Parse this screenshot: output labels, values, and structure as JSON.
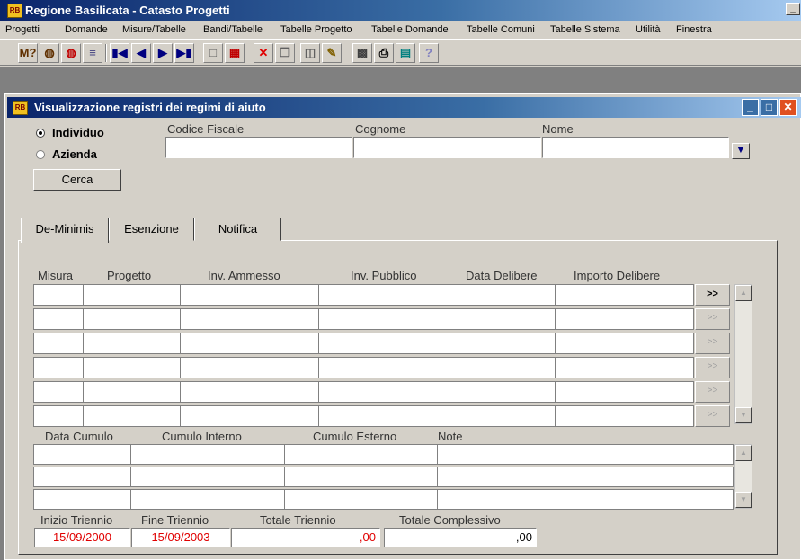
{
  "window": {
    "title": "Regione Basilicata - Catasto Progetti"
  },
  "menu": [
    "Progetti",
    "Domande",
    "Misure/Tabelle",
    "Bandi/Tabelle",
    "Tabelle Progetto",
    "Tabelle Domande",
    "Tabelle Comuni",
    "Tabelle Sistema",
    "Utilità",
    "Finestra"
  ],
  "toolbar_icons": [
    "search-plus-icon",
    "binoculars-icon",
    "binoculars-red-icon",
    "filter-icon",
    "first-record-icon",
    "prev-record-icon",
    "next-record-icon",
    "last-record-icon",
    "new-record-icon",
    "edit-record-icon",
    "delete-icon",
    "copy-icon",
    "paste-icon",
    "edit-pen-icon",
    "save-icon",
    "print-icon",
    "exit-icon",
    "help-icon"
  ],
  "child": {
    "title": "Visualizzazione registri dei regimi di aiuto"
  },
  "search": {
    "type_individuo": "Individuo",
    "type_azienda": "Azienda",
    "selected_type": "Individuo",
    "codice_fiscale_label": "Codice Fiscale",
    "cognome_label": "Cognome",
    "nome_label": "Nome",
    "codice_fiscale_value": "",
    "cognome_value": "",
    "nome_value": "",
    "cerca_label": "Cerca"
  },
  "tabs": [
    "De-Minimis",
    "Esenzione",
    "Notifica"
  ],
  "active_tab": "De-Minimis",
  "grid1": {
    "headers": [
      "Misura",
      "Progetto",
      "Inv. Ammesso",
      "Inv. Pubblico",
      "Data Delibere",
      "Importo Delibere"
    ],
    "row_button": ">>",
    "rows": 6
  },
  "grid2": {
    "headers": [
      "Data Cumulo",
      "Cumulo Interno",
      "Cumulo Esterno",
      "Note"
    ],
    "rows": 3
  },
  "totals": {
    "inizio_label": "Inizio Triennio",
    "fine_label": "Fine Triennio",
    "totale_triennio_label": "Totale Triennio",
    "totale_complessivo_label": "Totale Complessivo",
    "inizio_value": "15/09/2000",
    "fine_value": "15/09/2003",
    "totale_triennio_value": ",00",
    "totale_complessivo_value": ",00"
  },
  "colors": {
    "title_blue": "#0a246a",
    "date_red": "#e00000"
  }
}
